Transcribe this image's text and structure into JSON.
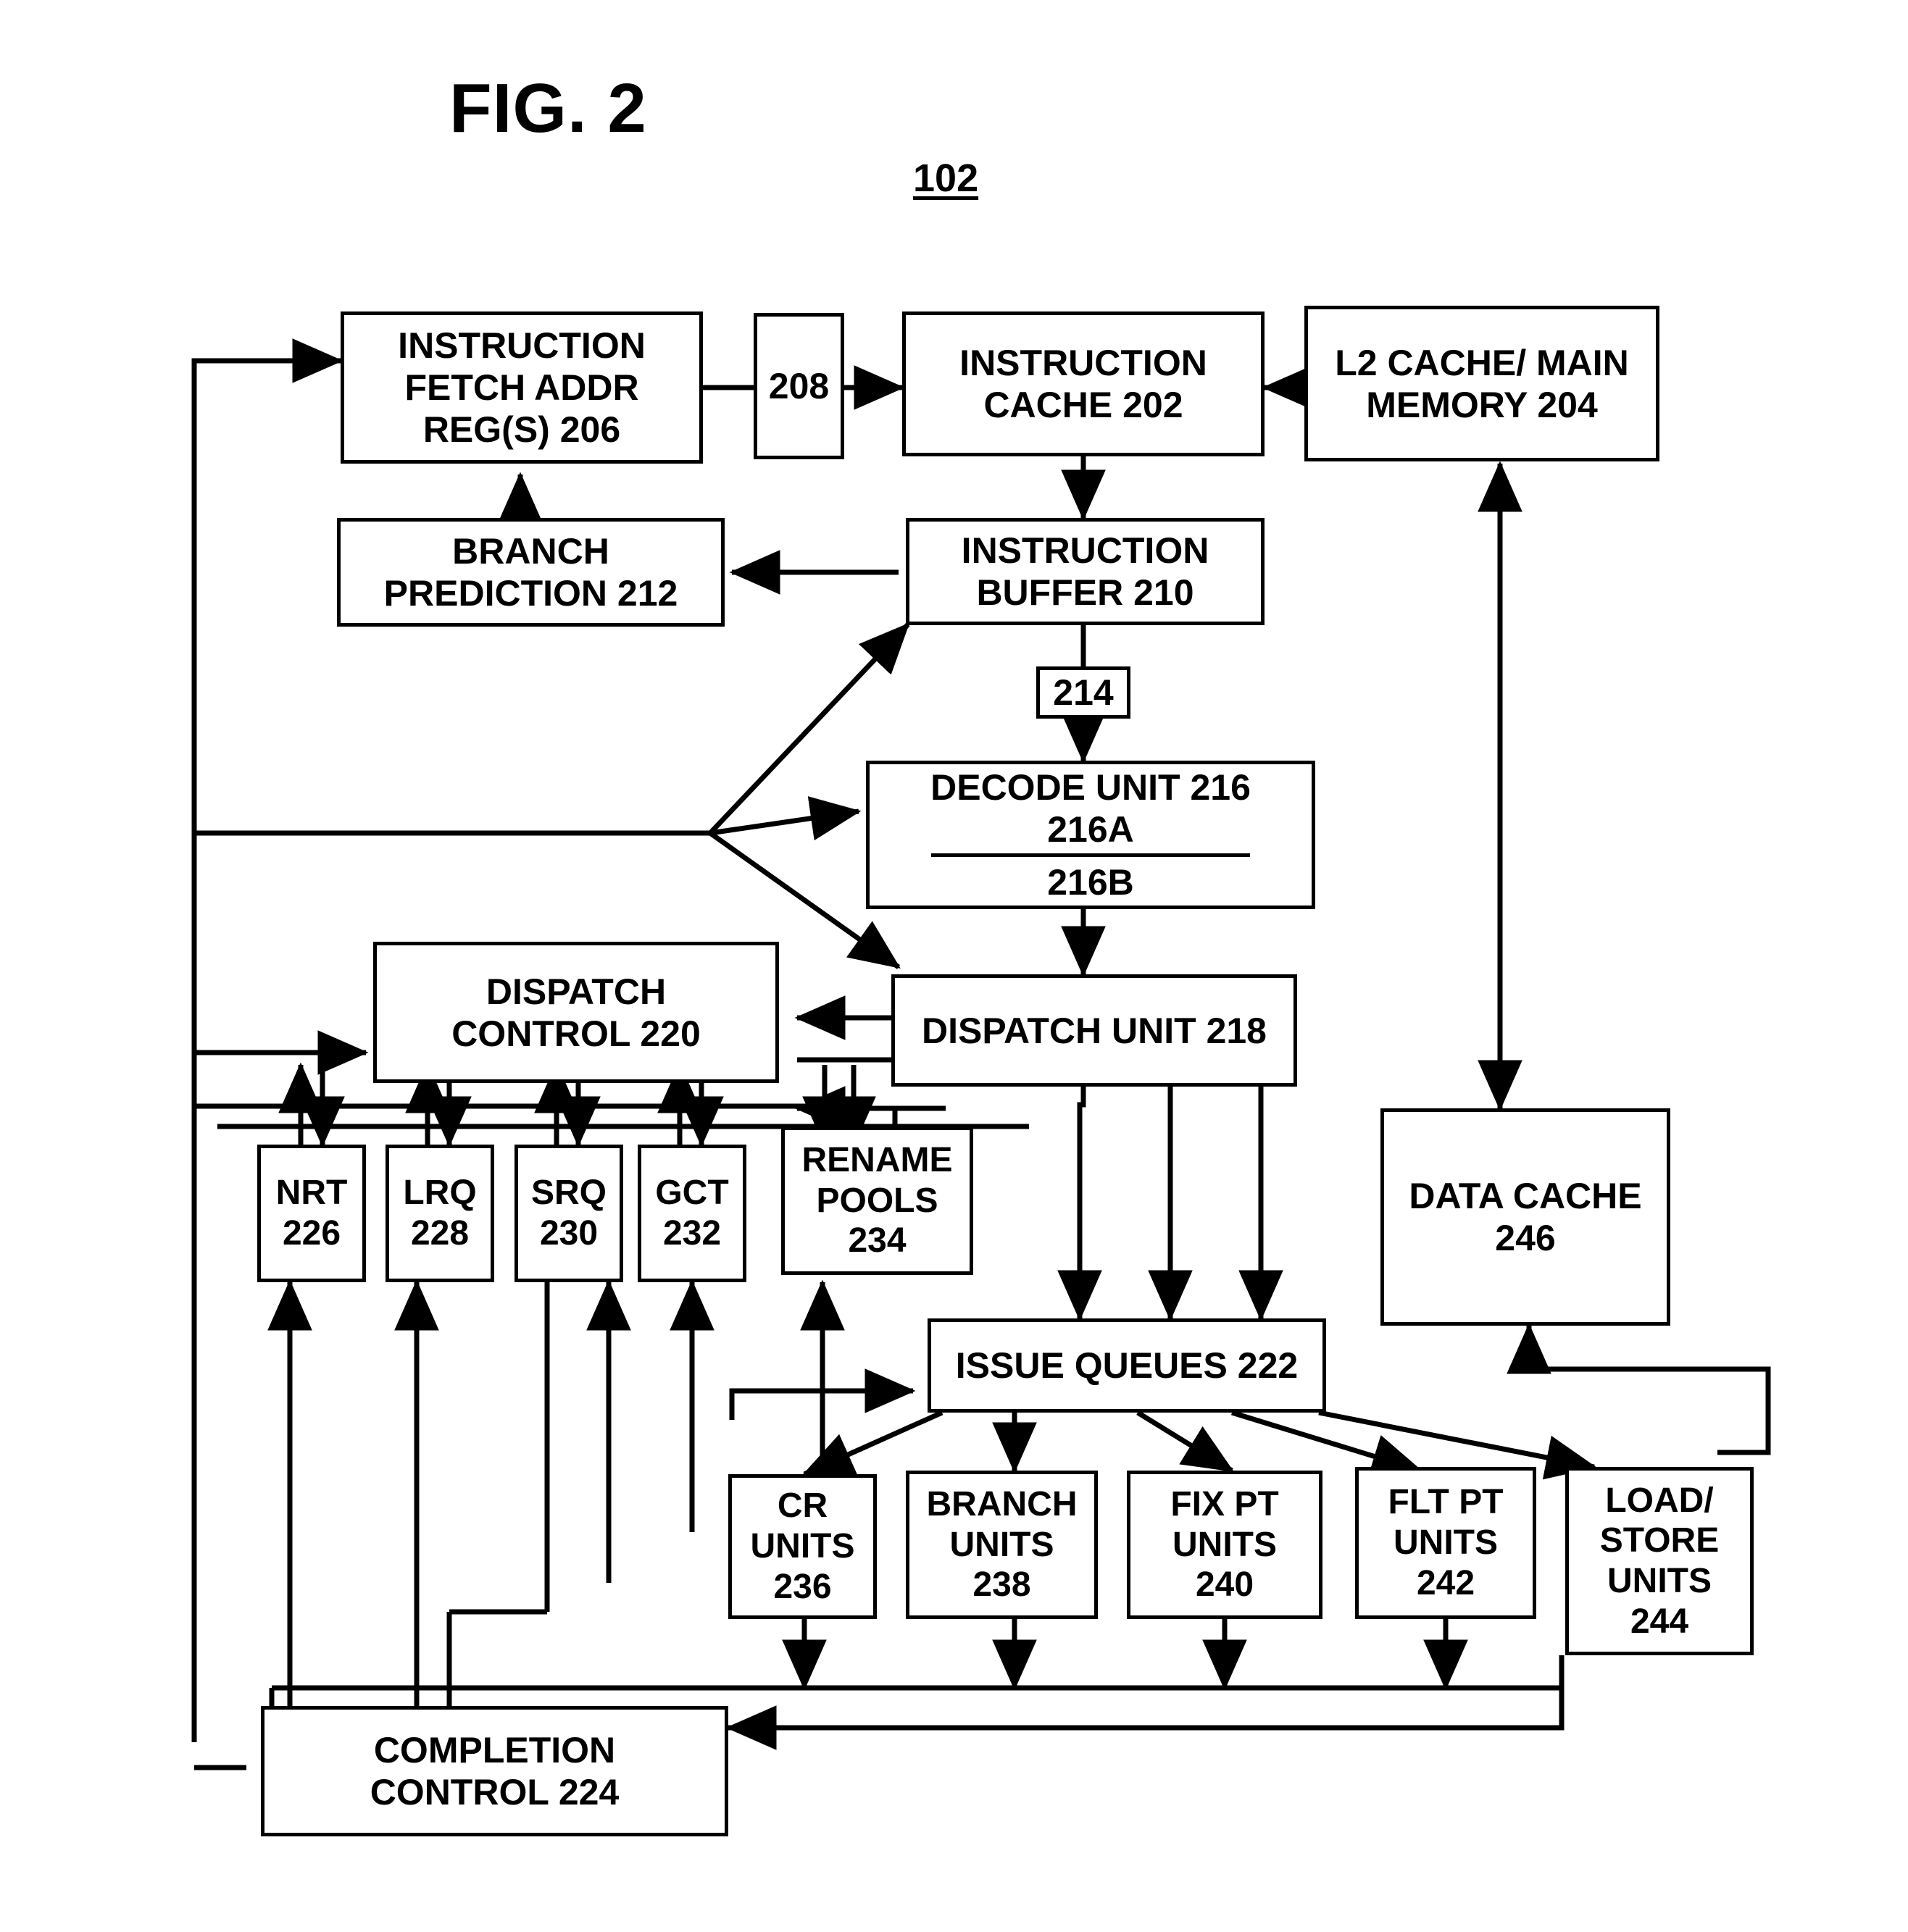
{
  "figure": {
    "title": "FIG. 2",
    "reference_numeral": "102"
  },
  "nodes": {
    "ifar": {
      "lines": [
        "INSTRUCTION",
        "FETCH ADDR",
        "REG(S) 206"
      ]
    },
    "n208": {
      "lines": [
        "208"
      ]
    },
    "icache": {
      "lines": [
        "INSTRUCTION",
        "CACHE 202"
      ]
    },
    "l2cache": {
      "lines": [
        "L2 CACHE/ MAIN",
        "MEMORY 204"
      ]
    },
    "branchpred": {
      "lines": [
        "BRANCH",
        "PREDICTION 212"
      ]
    },
    "ibuffer": {
      "lines": [
        "INSTRUCTION",
        "BUFFER 210"
      ]
    },
    "n214": {
      "lines": [
        "214"
      ]
    },
    "decode": {
      "lines": [
        "DECODE UNIT 216",
        "216A",
        "216B"
      ]
    },
    "dispctrl": {
      "lines": [
        "DISPATCH",
        "CONTROL 220"
      ]
    },
    "dispunit": {
      "lines": [
        "DISPATCH UNIT 218"
      ]
    },
    "nrt": {
      "lines": [
        "NRT",
        "226"
      ]
    },
    "lrq": {
      "lines": [
        "LRQ",
        "228"
      ]
    },
    "srq": {
      "lines": [
        "SRQ",
        "230"
      ]
    },
    "gct": {
      "lines": [
        "GCT",
        "232"
      ]
    },
    "rename": {
      "lines": [
        "RENAME",
        "POOLS",
        "234"
      ]
    },
    "datacache": {
      "lines": [
        "DATA CACHE",
        "246"
      ]
    },
    "issueq": {
      "lines": [
        "ISSUE QUEUES 222"
      ]
    },
    "crunits": {
      "lines": [
        "CR",
        "UNITS",
        "236"
      ]
    },
    "brunits": {
      "lines": [
        "BRANCH",
        "UNITS",
        "238"
      ]
    },
    "fxunits": {
      "lines": [
        "FIX PT",
        "UNITS",
        "240"
      ]
    },
    "fpunits": {
      "lines": [
        "FLT PT",
        "UNITS",
        "242"
      ]
    },
    "lsunits": {
      "lines": [
        "LOAD/",
        "STORE",
        "UNITS",
        "244"
      ]
    },
    "completion": {
      "lines": [
        "COMPLETION",
        "CONTROL 224"
      ]
    }
  },
  "colors": {
    "stroke": "#000000",
    "background": "#ffffff"
  }
}
